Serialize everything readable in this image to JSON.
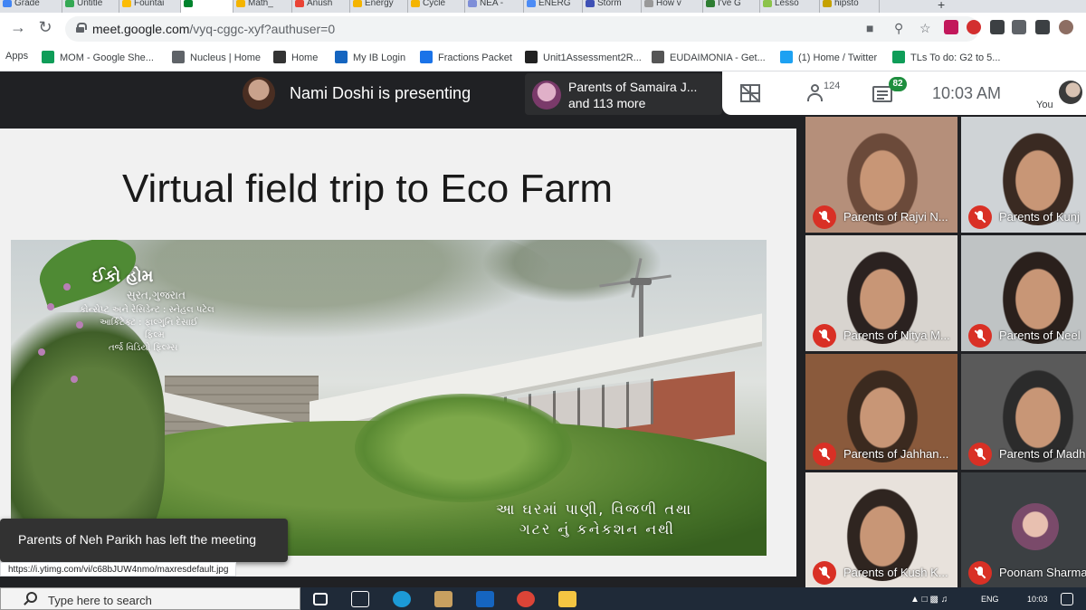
{
  "browser": {
    "tabs": [
      {
        "label": "Grade",
        "color": "#4285f4"
      },
      {
        "label": "Untitle",
        "color": "#34a853"
      },
      {
        "label": "Fountai",
        "color": "#fbbc05"
      },
      {
        "label": "",
        "color": "#00832d"
      },
      {
        "label": "Math_",
        "color": "#f4b400"
      },
      {
        "label": "Anush",
        "color": "#ea4335"
      },
      {
        "label": "Energy",
        "color": "#f4b400"
      },
      {
        "label": "Cycle",
        "color": "#f4b400"
      },
      {
        "label": "NEA -",
        "color": "#7e8ed8"
      },
      {
        "label": "ENERG",
        "color": "#4c8bf5"
      },
      {
        "label": "Storm",
        "color": "#3f51b5"
      },
      {
        "label": "How v",
        "color": "#999999"
      },
      {
        "label": "I've G",
        "color": "#2e7d32"
      },
      {
        "label": "Lesso",
        "color": "#8bc34a"
      },
      {
        "label": "hipsto",
        "color": "#c5a100"
      }
    ],
    "new_tab": "+",
    "url_host": "meet.google.com",
    "url_path": "/vyq-cggc-xyf?authuser=0",
    "bookmarks": [
      {
        "label": "Apps",
        "icon": "apps-grid",
        "color": "#5f6368"
      },
      {
        "label": "MOM - Google She...",
        "icon": "sheets",
        "color": "#0f9d58"
      },
      {
        "label": "Nucleus | Home",
        "icon": "gear",
        "color": "#5f6368"
      },
      {
        "label": "Home",
        "icon": "W",
        "color": "#333333"
      },
      {
        "label": "My IB Login",
        "icon": "cloud",
        "color": "#1565c0"
      },
      {
        "label": "Fractions Packet",
        "icon": "circle",
        "color": "#1a73e8"
      },
      {
        "label": "Unit1Assessment2R...",
        "icon": "Bb",
        "color": "#222222"
      },
      {
        "label": "EUDAIMONIA - Get...",
        "icon": "line",
        "color": "#555555"
      },
      {
        "label": "(1) Home / Twitter",
        "icon": "twitter",
        "color": "#1da1f2"
      },
      {
        "label": "TLs To do: G2 to 5...",
        "icon": "sheets",
        "color": "#0f9d58"
      }
    ]
  },
  "meet": {
    "presenter_text": "Nami Doshi is presenting",
    "second_line1": "Parents of Samaira J...",
    "second_line2": "and 113 more",
    "people_count": "124",
    "chat_count": "82",
    "time": "10:03  AM",
    "you_label": "You",
    "toast": "Parents of Neh Parikh has left the meeting",
    "status_url": "https://i.ytimg.com/vi/c68bJUW4nmo/maxresdefault.jpg"
  },
  "slide": {
    "title": "Virtual field trip to Eco Farm",
    "gu_title": "ઈકો હોમ",
    "gu_sub": "સુરત,ગુજરાત",
    "gu_credits": [
      "કોન્સેપ્ટ અને રેસિડેન્ટ : સ્નેહલ પટેલ",
      "આર્કિટેક્ટ : ફાલ્ગુનિ દેસાઈ",
      "ફિલ્મ",
      "તર્જ વિડિયો ફિલ્મ્સ"
    ],
    "gu_caption1": "આ ઘરમાં પાણી, વિજળી તથા",
    "gu_caption2": "ગટર નું કનેકશન નથી"
  },
  "participants": [
    {
      "name": "Parents of Rajvi N...",
      "bg": "#b58f7a",
      "face": "#6b4a3a"
    },
    {
      "name": "Parents of Kunj",
      "bg": "#cfd3d6",
      "face": "#3a2a22"
    },
    {
      "name": "Parents of Nitya M...",
      "bg": "#d8d4cf",
      "face": "#2b2220"
    },
    {
      "name": "Parents of Neel",
      "bg": "#bfc3c4",
      "face": "#2a201c"
    },
    {
      "name": "Parents of Jahhan...",
      "bg": "#8a5a3c",
      "face": "#3b2a1f"
    },
    {
      "name": "Parents of Madh",
      "bg": "#5a5a5a",
      "face": "#2b2b2b"
    },
    {
      "name": "Parents of Kush K...",
      "bg": "#e8e2dc",
      "face": "#2f2520"
    },
    {
      "name": "Poonam Sharma",
      "bg": "#3c4043",
      "face": "#7a4a6a"
    }
  ],
  "taskbar": {
    "search_placeholder": "Type here to search",
    "lang": "ENG",
    "time": "10:03"
  }
}
